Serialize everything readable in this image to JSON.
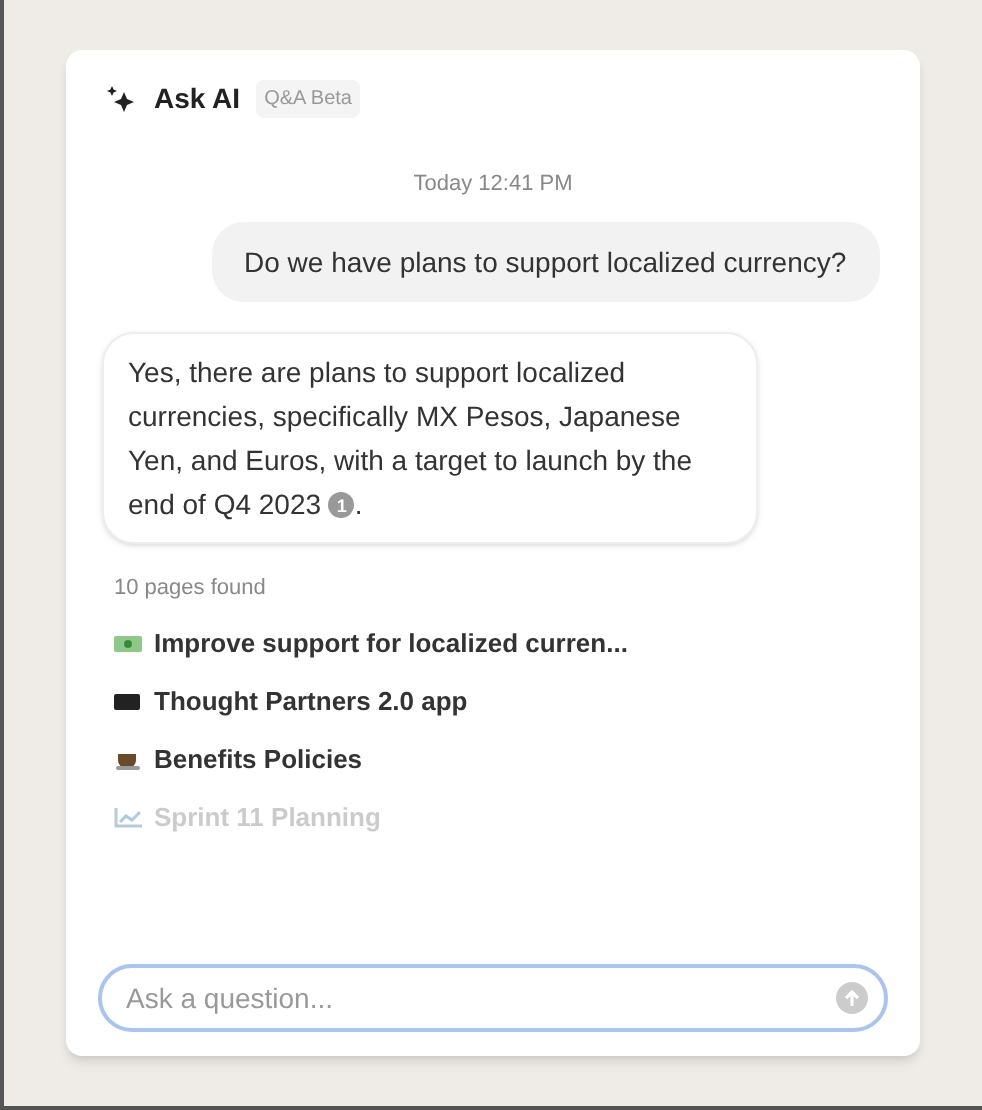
{
  "header": {
    "title": "Ask AI",
    "badge": "Q&A Beta"
  },
  "timestamp": "Today 12:41 PM",
  "question": "Do we have plans to support localized currency?",
  "answer": {
    "text": "Yes, there are plans to support localized currencies, specifically MX Pesos, Japanese Yen, and Euros, with a target to launch by the end of Q4 2023",
    "citation": "1",
    "end": "."
  },
  "pages": {
    "count": "10 pages found",
    "items": [
      {
        "kind": "money",
        "title": "Improve support for localized curren...",
        "faded": false
      },
      {
        "kind": "flag",
        "title": "Thought Partners 2.0 app",
        "faded": false
      },
      {
        "kind": "cup",
        "title": "Benefits Policies",
        "faded": false
      },
      {
        "kind": "chart",
        "title": "Sprint 11 Planning",
        "faded": true
      }
    ]
  },
  "input": {
    "placeholder": "Ask a question..."
  }
}
